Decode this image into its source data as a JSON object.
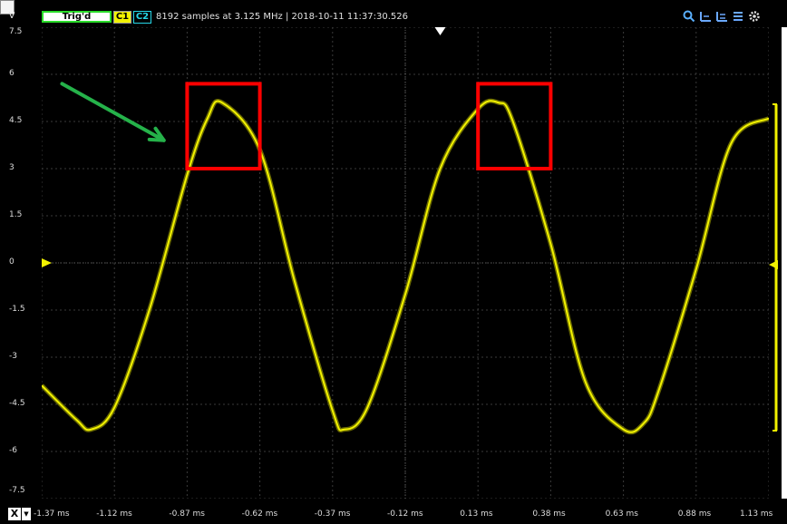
{
  "toolbar": {
    "units": "V",
    "trigger_status": "Trig'd",
    "channel1": "C1",
    "channel2": "C2",
    "status": "8192 samples at 3.125 MHz | 2018-10-11 11:37:30.526"
  },
  "icons": {
    "zoom": "magnifier-icon",
    "tool2": "measure-icon",
    "tool3": "measure-icon",
    "tool4": "measure-icon",
    "settings": "gear-icon",
    "close": "close-icon"
  },
  "colors": {
    "background": "#000000",
    "grid": "#3a3a3a",
    "trace": "#f2f200",
    "annotation_box": "#ff0000",
    "arrow": "#25b24a",
    "channel2": "#26d7e8"
  },
  "y_axis": {
    "labels": [
      "7.5",
      "6",
      "4.5",
      "3",
      "1.5",
      "0",
      "-1.5",
      "-3",
      "-4.5",
      "-6",
      "-7.5"
    ]
  },
  "x_axis": {
    "labels": [
      "-1.37 ms",
      "-1.12 ms",
      "-0.87 ms",
      "-0.62 ms",
      "-0.37 ms",
      "-0.12 ms",
      "0.13 ms",
      "0.38 ms",
      "0.63 ms",
      "0.88 ms",
      "1.13 ms"
    ],
    "mode_button": "X",
    "mode_dropdown": "▼"
  },
  "chart_data": {
    "type": "line",
    "units": "V",
    "xlim_ms": [
      -1.37,
      1.13
    ],
    "ylim": [
      -7.5,
      7.5
    ],
    "grid": true,
    "series": [
      {
        "color": "#f2f200",
        "x_ms": [
          -1.37,
          -1.25,
          -1.2,
          -1.12,
          -1.0,
          -0.87,
          -0.8,
          -0.75,
          -0.62,
          -0.5,
          -0.37,
          -0.33,
          -0.25,
          -0.12,
          0.0,
          0.13,
          0.2,
          0.25,
          0.38,
          0.5,
          0.63,
          0.7,
          0.75,
          0.88,
          1.0,
          1.13
        ],
        "y": [
          -3.9,
          -5.0,
          -5.3,
          -4.6,
          -1.5,
          2.8,
          4.6,
          5.1,
          3.6,
          -0.6,
          -4.7,
          -5.3,
          -4.6,
          -1.0,
          3.0,
          4.9,
          5.1,
          4.5,
          0.6,
          -3.8,
          -5.3,
          -5.1,
          -4.1,
          -0.2,
          3.8,
          4.6
        ]
      }
    ],
    "annotations": [
      {
        "type": "box",
        "x_ms": [
          -0.87,
          -0.62
        ],
        "y": [
          3.0,
          5.7
        ],
        "color": "#ff0000"
      },
      {
        "type": "box",
        "x_ms": [
          0.13,
          0.38
        ],
        "y": [
          3.0,
          5.7
        ],
        "color": "#ff0000"
      },
      {
        "type": "arrow",
        "from": {
          "x_ms": -1.3,
          "y": 5.7
        },
        "to": {
          "x_ms": -0.95,
          "y": 3.9
        },
        "color": "#25b24a"
      }
    ]
  }
}
